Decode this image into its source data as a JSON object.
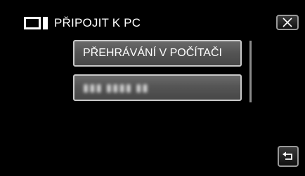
{
  "header": {
    "title": "PŘIPOJIT K PC",
    "icon": "pc-connection-icon"
  },
  "buttons": {
    "close": "close-icon",
    "back": "return-icon"
  },
  "menu": {
    "items": [
      {
        "label": "PŘEHRÁVÁNÍ V POČÍTAČI"
      },
      {
        "label": "▮▮▮ ▮▮▮▮ ▮▮"
      }
    ]
  },
  "colors": {
    "background": "#000000",
    "button_border": "#c8c8c8",
    "button_fill": "#555555",
    "text": "#ffffff"
  }
}
